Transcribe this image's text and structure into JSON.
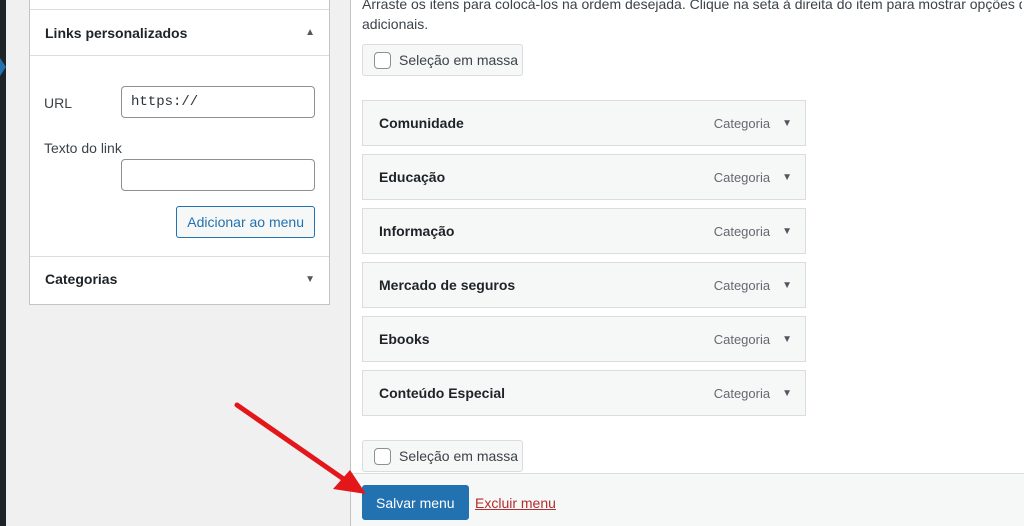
{
  "custom_links": {
    "title": "Links personalizados",
    "url_label": "URL",
    "url_value": "https://",
    "link_text_label": "Texto do link",
    "link_text_value": "",
    "add_button": "Adicionar ao menu"
  },
  "categories": {
    "title": "Categorias"
  },
  "instructions": {
    "line1": "Arraste os itens para colocá-los na ordem desejada. Clique na seta à direita do item para mostrar opções de",
    "line2": "adicionais."
  },
  "bulk_select_label": "Seleção em massa",
  "menu_items": [
    {
      "title": "Comunidade",
      "type": "Categoria"
    },
    {
      "title": "Educação",
      "type": "Categoria"
    },
    {
      "title": "Informação",
      "type": "Categoria"
    },
    {
      "title": "Mercado de seguros",
      "type": "Categoria"
    },
    {
      "title": "Ebooks",
      "type": "Categoria"
    },
    {
      "title": "Conteúdo Especial",
      "type": "Categoria"
    }
  ],
  "footer": {
    "save_label": "Salvar menu",
    "delete_label": "Excluir menu"
  },
  "colors": {
    "primary": "#2271b1",
    "danger": "#b32d2e",
    "annotation_arrow": "#e3161a"
  }
}
